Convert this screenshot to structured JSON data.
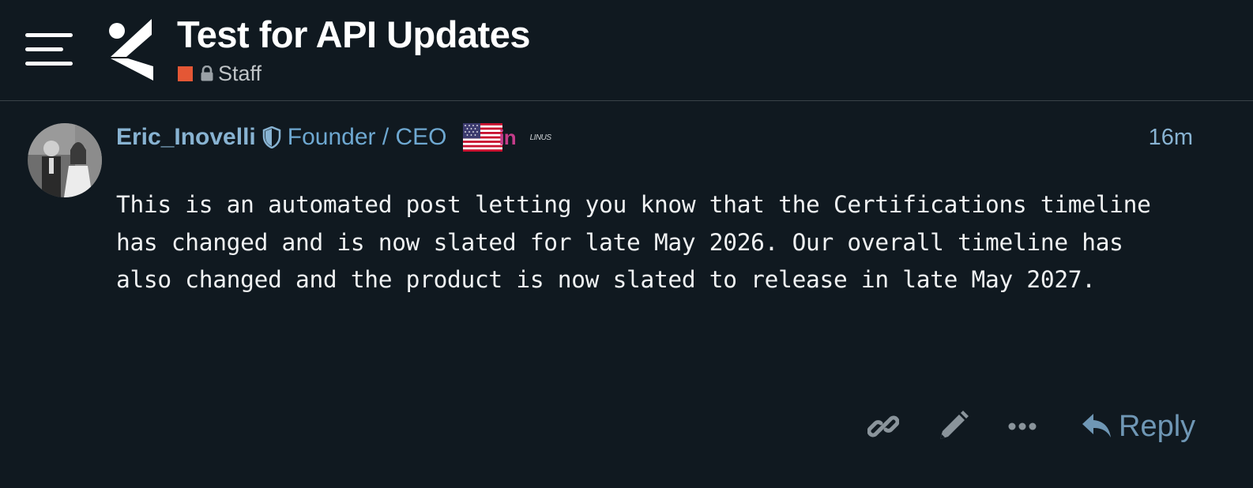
{
  "header": {
    "title": "Test for API Updates",
    "category": {
      "label": "Staff",
      "color": "#e45735",
      "icon": "lock-icon"
    },
    "menu_icon": "hamburger-icon",
    "logo": "inovelli-logo"
  },
  "post": {
    "author": {
      "username": "Eric_Inovelli",
      "title": "Founder / CEO",
      "moderator_icon": "shield-icon",
      "flag_icon": "us-flag-icon",
      "in_badge": "in",
      "small_badge": "LINUS"
    },
    "timestamp": "16m",
    "body": "This is an automated post letting you know that the Certifications timeline has changed and is now slated for late May 2026. Our overall timeline has also changed and the product is now slated to release in late May 2027.",
    "actions": {
      "copy_link_icon": "link-icon",
      "edit_icon": "pencil-icon",
      "more_icon": "ellipsis-icon",
      "reply_label": "Reply"
    }
  },
  "colors": {
    "background": "#101920",
    "link_blue": "#88b3d2",
    "title_blue": "#6ea8d1",
    "action_gray": "#8a949b",
    "reply_blue": "#6f97b5"
  }
}
